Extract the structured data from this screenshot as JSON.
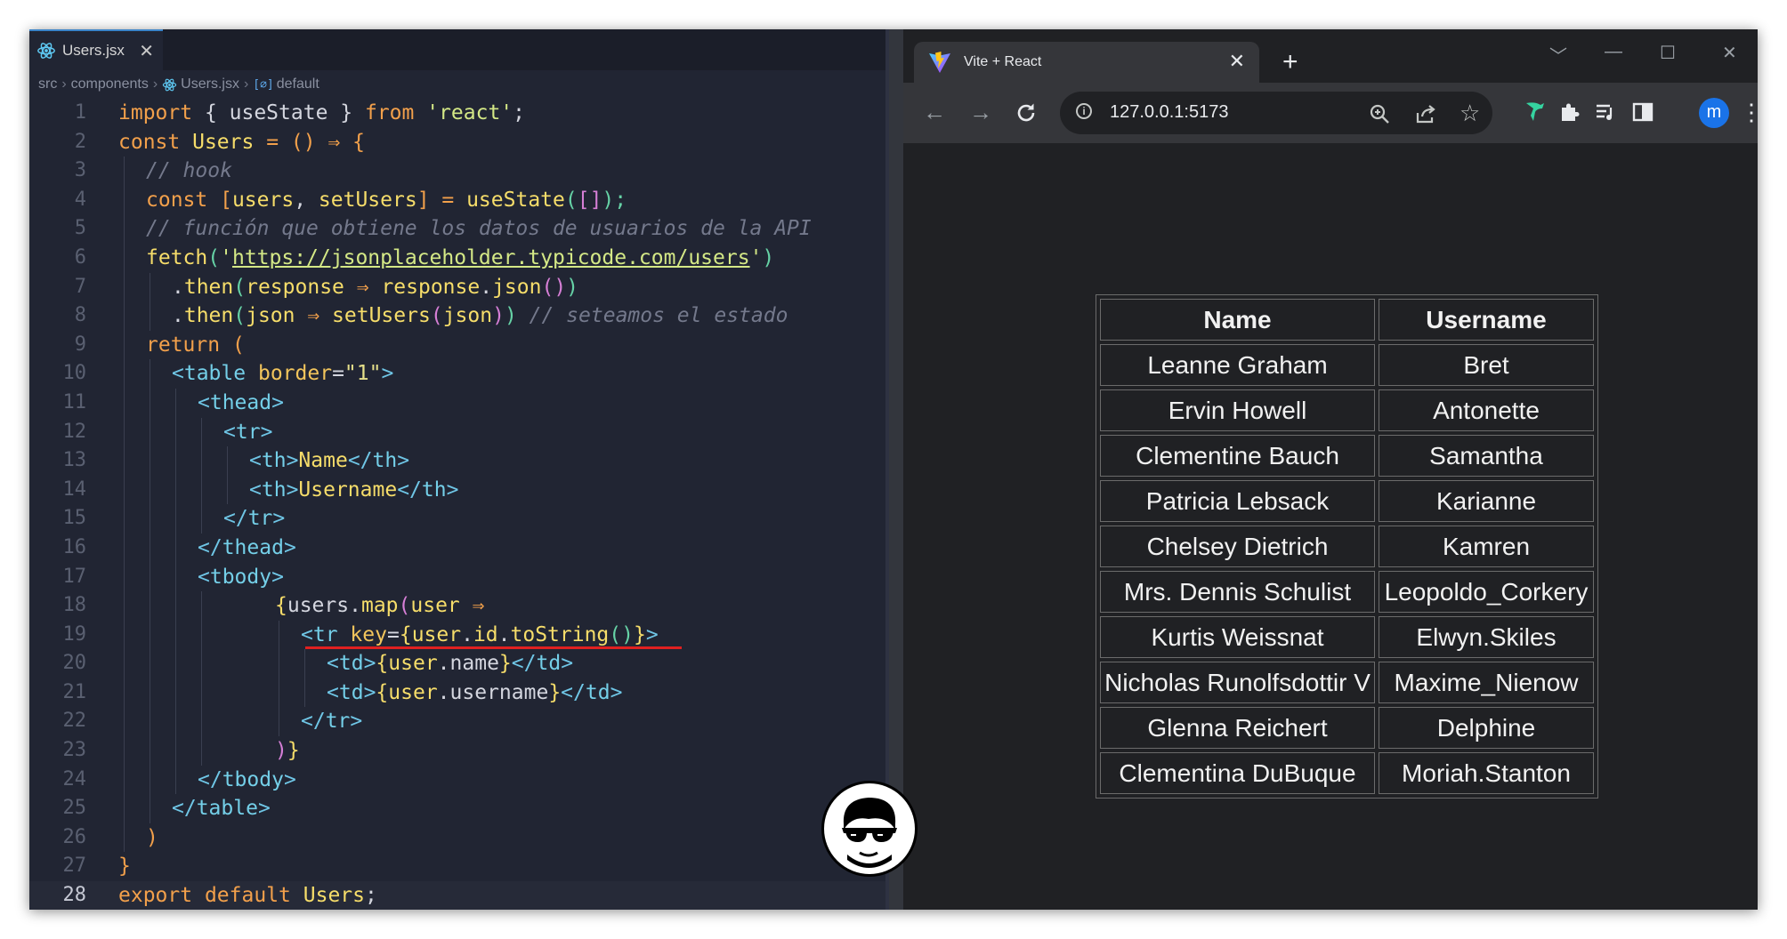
{
  "editor": {
    "tab_title": "Users.jsx",
    "tab_close": "✕",
    "breadcrumb": [
      "src",
      "components",
      "Users.jsx",
      "default"
    ],
    "breadcrumb_symbol": "[∅]",
    "line_numbers": [
      "1",
      "2",
      "3",
      "4",
      "5",
      "6",
      "7",
      "8",
      "9",
      "10",
      "11",
      "12",
      "13",
      "14",
      "15",
      "16",
      "17",
      "18",
      "19",
      "20",
      "21",
      "22",
      "23",
      "24",
      "25",
      "26",
      "27",
      "28"
    ],
    "code": {
      "l1": [
        "import",
        " { ",
        "useState",
        " } ",
        "from",
        " ",
        "'react'",
        ";"
      ],
      "l2": [
        "const",
        " ",
        "Users",
        " = ",
        "()",
        " ⇒ {"
      ],
      "l3": [
        "// hook"
      ],
      "l4": [
        "const",
        " [",
        "users",
        ", ",
        "setUsers",
        "] = ",
        "useState",
        "(",
        "[]",
        ");"
      ],
      "l5": [
        "// función que obtiene los datos de usuarios de la API"
      ],
      "l6": [
        "fetch",
        "(",
        "'",
        "https://jsonplaceholder.typicode.com/users",
        "'",
        ")"
      ],
      "l7": [
        ".",
        "then",
        "(",
        "response",
        " ⇒ ",
        "response",
        ".",
        "json",
        "()",
        ")"
      ],
      "l8": [
        ".",
        "then",
        "(",
        "json",
        " ⇒ ",
        "setUsers",
        "(",
        "json",
        ")",
        ")",
        " // seteamos el estado"
      ],
      "l9": [
        "return",
        " ("
      ],
      "l10": [
        "<",
        "table",
        " ",
        "border",
        "=",
        "\"1\"",
        ">"
      ],
      "l11": [
        "<",
        "thead",
        ">"
      ],
      "l12": [
        "<",
        "tr",
        ">"
      ],
      "l13": [
        "<",
        "th",
        ">",
        "Name",
        "</",
        "th",
        ">"
      ],
      "l14": [
        "<",
        "th",
        ">",
        "Username",
        "</",
        "th",
        ">"
      ],
      "l15": [
        "</",
        "tr",
        ">"
      ],
      "l16": [
        "</",
        "thead",
        ">"
      ],
      "l17": [
        "<",
        "tbody",
        ">"
      ],
      "l18": [
        "{",
        "users",
        ".",
        "map",
        "(",
        "user",
        " ⇒"
      ],
      "l19": [
        "<",
        "tr",
        " ",
        "key",
        "=",
        "{",
        "user",
        ".",
        "id",
        ".",
        "toString",
        "()",
        "}",
        ">"
      ],
      "l20": [
        "<",
        "td",
        ">",
        "{",
        "user",
        ".",
        "name",
        "}",
        "</",
        "td",
        ">"
      ],
      "l21": [
        "<",
        "td",
        ">",
        "{",
        "user",
        ".",
        "username",
        "}",
        "</",
        "td",
        ">"
      ],
      "l22": [
        "</",
        "tr",
        ">"
      ],
      "l23": [
        ")",
        "}"
      ],
      "l24": [
        "</",
        "tbody",
        ">"
      ],
      "l25": [
        "</",
        "table",
        ">"
      ],
      "l26": [
        ")"
      ],
      "l27": [
        "}"
      ],
      "l28": [
        "export",
        " ",
        "default",
        " ",
        "Users",
        ";"
      ]
    }
  },
  "browser": {
    "tab_title": "Vite + React",
    "tab_close": "✕",
    "new_tab": "+",
    "url": "127.0.0.1:5173",
    "profile_initial": "m",
    "window_controls": [
      "﹀",
      "—",
      "☐",
      "✕"
    ]
  },
  "table": {
    "headers": [
      "Name",
      "Username"
    ],
    "rows": [
      [
        "Leanne Graham",
        "Bret"
      ],
      [
        "Ervin Howell",
        "Antonette"
      ],
      [
        "Clementine Bauch",
        "Samantha"
      ],
      [
        "Patricia Lebsack",
        "Karianne"
      ],
      [
        "Chelsey Dietrich",
        "Kamren"
      ],
      [
        "Mrs. Dennis Schulist",
        "Leopoldo_Corkery"
      ],
      [
        "Kurtis Weissnat",
        "Elwyn.Skiles"
      ],
      [
        "Nicholas Runolfsdottir V",
        "Maxime_Nienow"
      ],
      [
        "Glenna Reichert",
        "Delphine"
      ],
      [
        "Clementina DuBuque",
        "Moriah.Stanton"
      ]
    ]
  },
  "colors": {
    "editor_bg": "#212533",
    "browser_bg": "#202124",
    "underline_highlight": "#e02020",
    "keyword": "#f2a04b",
    "function": "#f6dd6a",
    "string": "#d4e886",
    "tag": "#74cfe8"
  },
  "icons": [
    "react-icon",
    "vite-icon",
    "back-icon",
    "forward-icon",
    "reload-icon",
    "info-icon",
    "zoom-icon",
    "share-icon",
    "star-icon",
    "extension-puzzle-icon",
    "media-icon",
    "sidepanel-icon",
    "kebab-menu-icon",
    "avatar-logo"
  ]
}
